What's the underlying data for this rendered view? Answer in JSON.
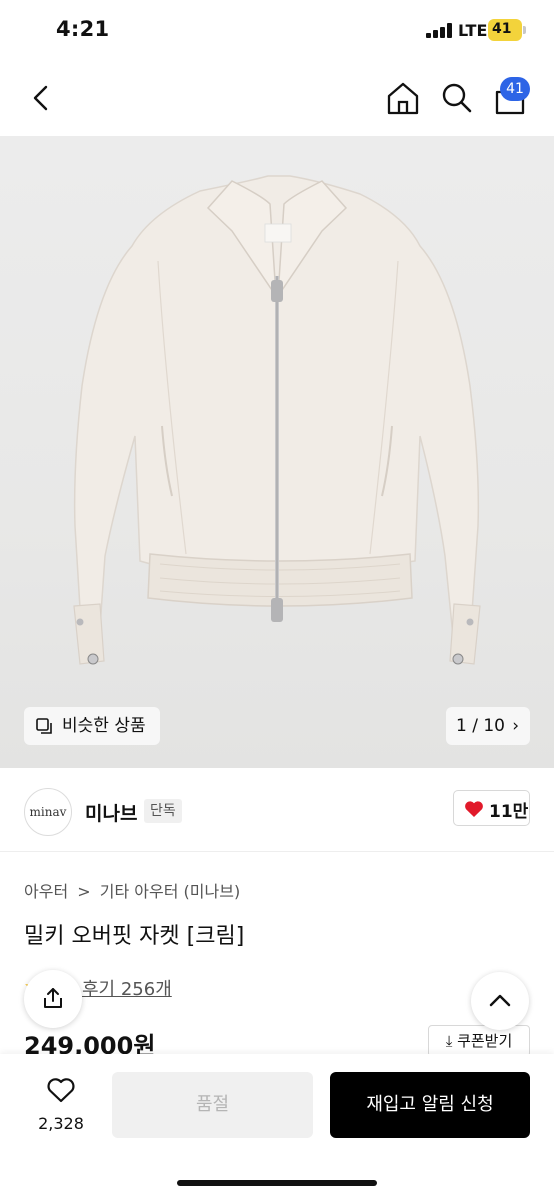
{
  "status_bar": {
    "time": "4:21",
    "network": "LTE",
    "battery": "41"
  },
  "nav": {
    "back_icon": "chevron-left-icon",
    "home_icon": "home-icon",
    "search_icon": "search-icon",
    "cart_icon": "cart-icon",
    "cart_count": "41",
    "badge_color": "#2d64e6"
  },
  "gallery": {
    "similar_label": "비슷한 상품",
    "counter": "1 / 10",
    "counter_chevron": "›"
  },
  "brand": {
    "logo_text": "minav",
    "name": "미나브",
    "exclusive_tag": "단독",
    "like_count": "11만",
    "like_color": "#e1192a"
  },
  "product": {
    "breadcrumb": [
      "아우터",
      ">",
      "기타 아우터 (미나브)"
    ],
    "title": "밀키 오버핏 자켓 [크림]",
    "review_text": "후기 256개",
    "price": "249,000원",
    "coupon_label": "⤓ 쿠폰받기"
  },
  "bottom_bar": {
    "wish_count": "2,328",
    "soldout_label": "품절",
    "restock_label": "재입고 알림 신청"
  }
}
